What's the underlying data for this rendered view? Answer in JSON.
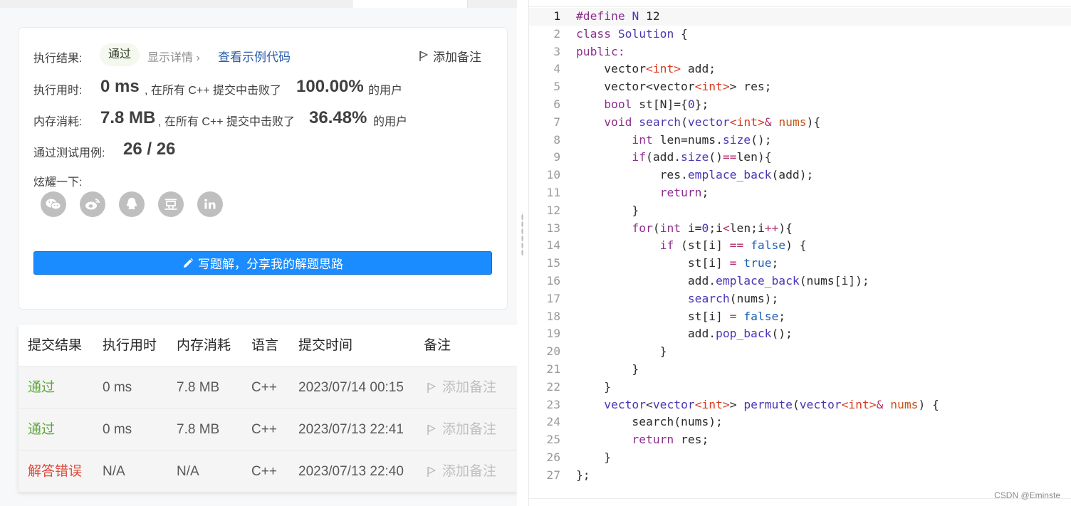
{
  "result": {
    "exec_label": "执行结果:",
    "status": "通过",
    "details_link": "显示详情 ›",
    "example_link": "查看示例代码",
    "add_note": "添加备注",
    "time_label": "执行用时:",
    "time_value": "0 ms",
    "time_text": ", 在所有 C++ 提交中击败了",
    "time_percent": "100.00%",
    "time_suffix": "的用户",
    "mem_label": "内存消耗:",
    "mem_value": "7.8 MB",
    "mem_text": ", 在所有 C++ 提交中击败了",
    "mem_percent": "36.48%",
    "mem_suffix": "的用户",
    "cases_label": "通过测试用例:",
    "cases_value": "26 / 26",
    "share_label": "炫耀一下:",
    "share_icons": [
      "wechat-icon",
      "weibo-icon",
      "qq-icon",
      "douban-icon",
      "linkedin-icon"
    ],
    "write_button": "写题解，分享我的解题思路"
  },
  "submissions": {
    "headers": [
      "提交结果",
      "执行用时",
      "内存消耗",
      "语言",
      "提交时间",
      "备注"
    ],
    "rows": [
      {
        "status": "通过",
        "time": "0 ms",
        "memory": "7.8 MB",
        "lang": "C++",
        "submitted": "2023/07/14 00:15",
        "note": "添加备注"
      },
      {
        "status": "通过",
        "time": "0 ms",
        "memory": "7.8 MB",
        "lang": "C++",
        "submitted": "2023/07/13 22:41",
        "note": "添加备注"
      },
      {
        "status": "解答错误",
        "time": "N/A",
        "memory": "N/A",
        "lang": "C++",
        "submitted": "2023/07/13 22:40",
        "note": "添加备注"
      }
    ]
  },
  "editor": {
    "line_numbers": [
      "1",
      "2",
      "3",
      "4",
      "5",
      "6",
      "7",
      "8",
      "9",
      "10",
      "11",
      "12",
      "13",
      "14",
      "15",
      "16",
      "17",
      "18",
      "19",
      "20",
      "21",
      "22",
      "23",
      "24",
      "25",
      "26",
      "27"
    ]
  },
  "watermark": "CSDN @Eminste",
  "colors": {
    "accent_blue": "#1a8cff",
    "pass_green": "#5fa83e",
    "fail_red": "#dd4b39"
  }
}
